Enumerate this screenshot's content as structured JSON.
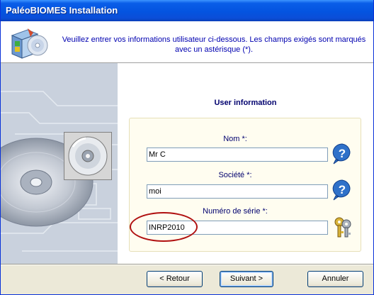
{
  "window": {
    "title": "PaléoBIOMES Installation"
  },
  "header": {
    "message": "Veuillez entrer vos informations utilisateur ci-dessous. Les champs exigés sont marqués avec un astérisque (*)."
  },
  "form": {
    "heading": "User information",
    "name_label": "Nom *:",
    "name_value": "Mr C",
    "company_label": "Société *:",
    "company_value": "moi",
    "serial_label": "Numéro de série *:",
    "serial_value": "INRP2010"
  },
  "buttons": {
    "back": "< Retour",
    "next": "Suivant >",
    "cancel": "Annuler"
  },
  "icons": [
    "installer-icon",
    "cd-icon",
    "help-icon",
    "keys-icon"
  ]
}
